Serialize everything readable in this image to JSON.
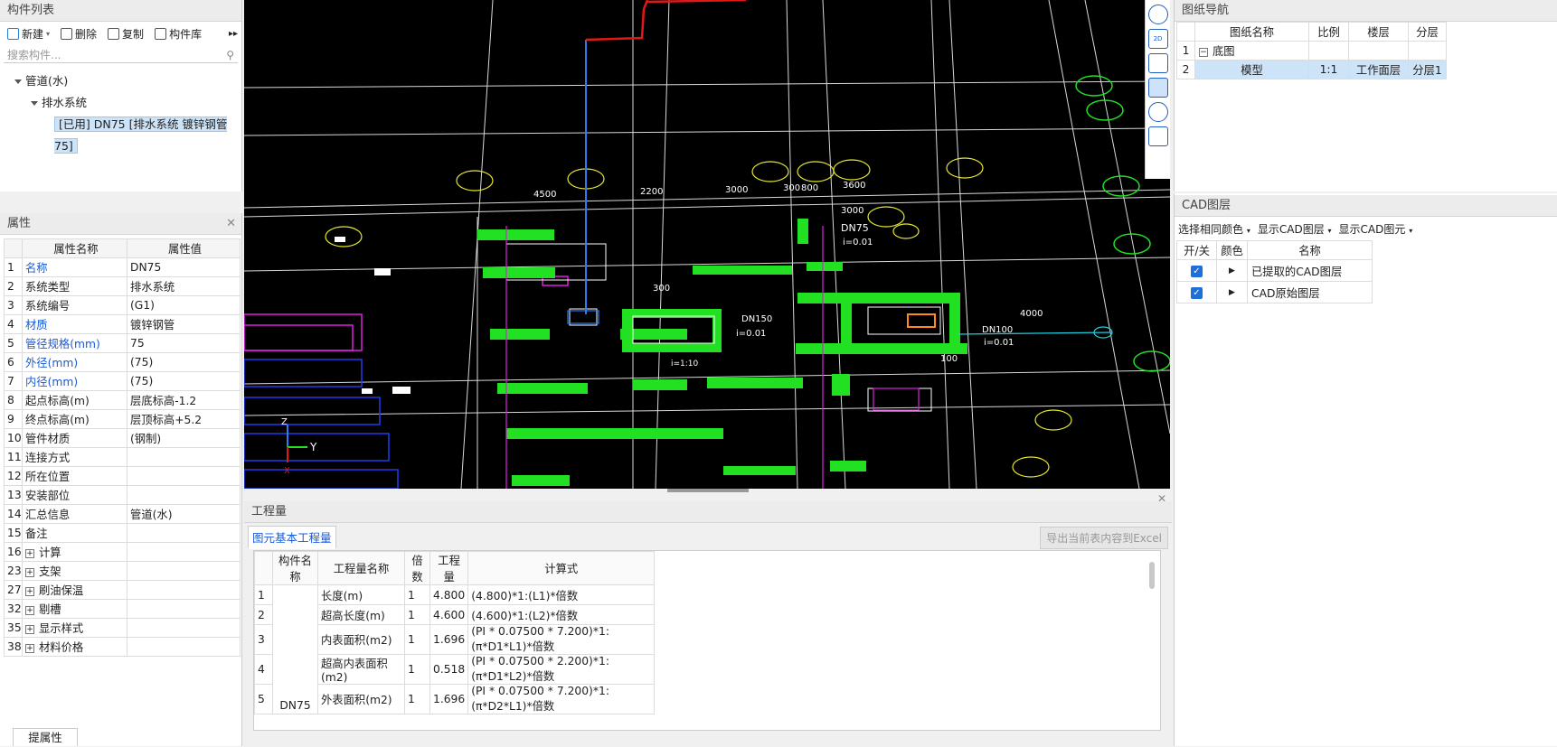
{
  "component_list": {
    "title": "构件列表",
    "toolbar": [
      "新建",
      "删除",
      "复制",
      "构件库"
    ],
    "search_placeholder": "搜索构件...",
    "tree": [
      {
        "label": "管道(水)",
        "level": 0
      },
      {
        "label": "排水系统",
        "level": 1
      },
      {
        "label": "[已用] DN75 [排水系统 镀锌钢管 75]",
        "level": 2,
        "selected": true
      }
    ]
  },
  "properties": {
    "title": "属性",
    "col_name": "属性名称",
    "col_value": "属性值",
    "rows": [
      {
        "n": "1",
        "name": "名称",
        "value": "DN75",
        "blue": true
      },
      {
        "n": "2",
        "name": "系统类型",
        "value": "排水系统"
      },
      {
        "n": "3",
        "name": "系统编号",
        "value": "(G1)"
      },
      {
        "n": "4",
        "name": "材质",
        "value": "镀锌钢管",
        "blue": true
      },
      {
        "n": "5",
        "name": "管径规格(mm)",
        "value": "75",
        "blue": true
      },
      {
        "n": "6",
        "name": "外径(mm)",
        "value": "(75)",
        "blue": true
      },
      {
        "n": "7",
        "name": "内径(mm)",
        "value": "(75)",
        "blue": true
      },
      {
        "n": "8",
        "name": "起点标高(m)",
        "value": "层底标高-1.2"
      },
      {
        "n": "9",
        "name": "终点标高(m)",
        "value": "层顶标高+5.2"
      },
      {
        "n": "10",
        "name": "管件材质",
        "value": "(钢制)"
      },
      {
        "n": "11",
        "name": "连接方式",
        "value": ""
      },
      {
        "n": "12",
        "name": "所在位置",
        "value": ""
      },
      {
        "n": "13",
        "name": "安装部位",
        "value": ""
      },
      {
        "n": "14",
        "name": "汇总信息",
        "value": "管道(水)"
      },
      {
        "n": "15",
        "name": "备注",
        "value": ""
      },
      {
        "n": "16",
        "name": "计算",
        "value": "",
        "group": true
      },
      {
        "n": "23",
        "name": "支架",
        "value": "",
        "group": true
      },
      {
        "n": "27",
        "name": "刷油保温",
        "value": "",
        "group": true
      },
      {
        "n": "32",
        "name": "剔槽",
        "value": "",
        "group": true
      },
      {
        "n": "35",
        "name": "显示样式",
        "value": "",
        "group": true
      },
      {
        "n": "38",
        "name": "材料价格",
        "value": "",
        "group": true
      }
    ],
    "bottom_tab": "提属性"
  },
  "quantities": {
    "title": "工程量",
    "tab": "图元基本工程量",
    "export_button": "导出当前表内容到Excel",
    "headers": [
      "构件名称",
      "工程量名称",
      "倍数",
      "工程量",
      "计算式"
    ],
    "component": "DN75",
    "rows": [
      {
        "n": "1",
        "name": "长度(m)",
        "mult": "1",
        "qty": "4.800",
        "formula": "(4.800)*1:(L1)*倍数"
      },
      {
        "n": "2",
        "name": "超高长度(m)",
        "mult": "1",
        "qty": "4.600",
        "formula": "(4.600)*1:(L2)*倍数"
      },
      {
        "n": "3",
        "name": "内表面积(m2)",
        "mult": "1",
        "qty": "1.696",
        "formula": "(PI * 0.07500 * 7.200)*1:(π*D1*L1)*倍数"
      },
      {
        "n": "4",
        "name": "超高内表面积(m2)",
        "mult": "1",
        "qty": "0.518",
        "formula": "(PI * 0.07500 * 2.200)*1:(π*D1*L2)*倍数"
      },
      {
        "n": "5",
        "name": "外表面积(m2)",
        "mult": "1",
        "qty": "1.696",
        "formula": "(PI * 0.07500 * 7.200)*1:(π*D2*L1)*倍数"
      }
    ]
  },
  "drawing_nav": {
    "title": "图纸导航",
    "headers": [
      "图纸名称",
      "比例",
      "楼层",
      "分层"
    ],
    "rows": [
      {
        "n": "1",
        "name": "底图",
        "scale": "",
        "floor": "",
        "layer": ""
      },
      {
        "n": "2",
        "name": "模型",
        "scale": "1:1",
        "floor": "工作面层",
        "layer": "分层1"
      }
    ]
  },
  "cad_layers": {
    "title": "CAD图层",
    "toolbar": [
      "选择相同颜色",
      "显示CAD图层",
      "显示CAD图元"
    ],
    "headers": [
      "开/关",
      "颜色",
      "名称"
    ],
    "rows": [
      {
        "name": "已提取的CAD图层",
        "on": true
      },
      {
        "name": "CAD原始图层",
        "on": true
      }
    ]
  },
  "cad_labels": {
    "dims": [
      "4500",
      "2200",
      "3000",
      "300",
      "800",
      "3600",
      "3000",
      "300",
      "100",
      "4000"
    ],
    "dn75": "DN75",
    "slope1": "i=0.01",
    "dn150": "DN150",
    "slope2": "i=0.01",
    "dn100": "DN100",
    "slope3": "i=0.01",
    "slope4": "i=1:10",
    "axis_y": "Y",
    "axis_z": "Z",
    "axis_x": "X"
  },
  "colors": {
    "canvas_bg": "#000000",
    "green": "#22e022",
    "accent": "#1e6fd9",
    "pipe_blue": "#2f7cf2",
    "pipe_red": "#e01818",
    "magenta": "#e020e0"
  }
}
